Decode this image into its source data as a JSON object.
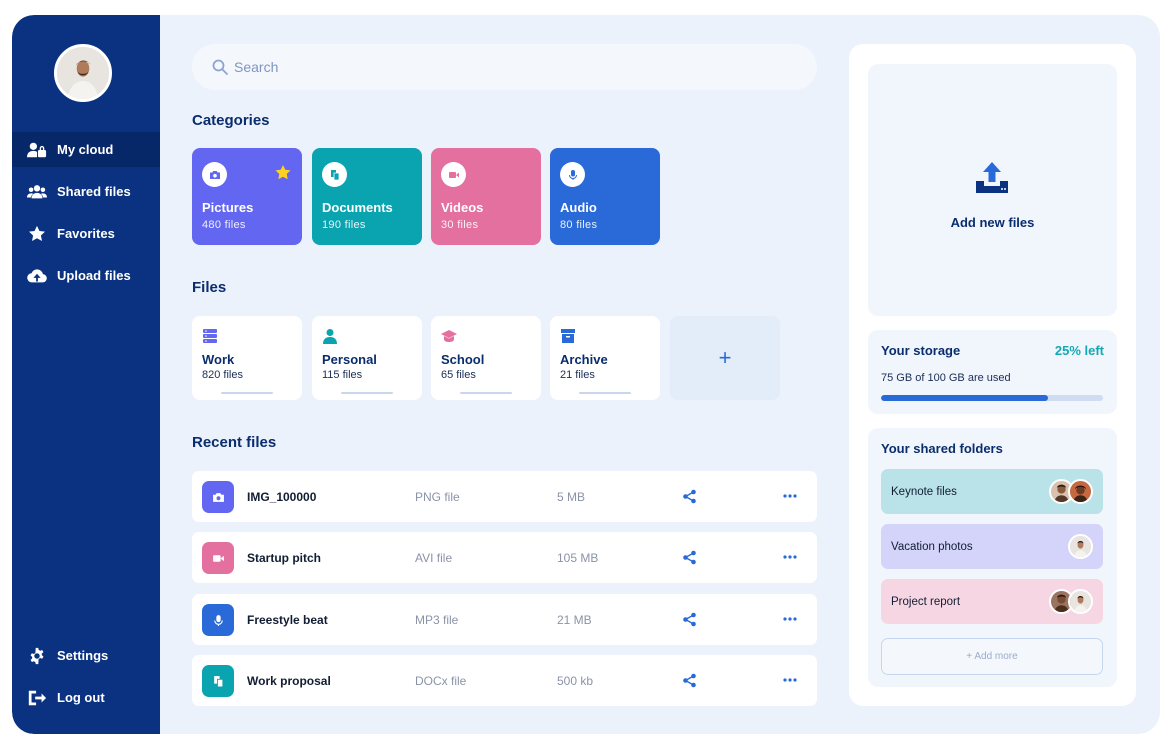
{
  "sidebar": {
    "items": [
      {
        "label": "My cloud",
        "icon": "user-lock-icon",
        "active": true
      },
      {
        "label": "Shared files",
        "icon": "users-icon"
      },
      {
        "label": "Favorites",
        "icon": "star-icon"
      },
      {
        "label": "Upload files",
        "icon": "cloud-upload-icon"
      }
    ],
    "bottom": [
      {
        "label": "Settings",
        "icon": "gear-icon"
      },
      {
        "label": "Log out",
        "icon": "logout-icon"
      }
    ]
  },
  "search": {
    "placeholder": "Search"
  },
  "categories": {
    "title": "Categories",
    "items": [
      {
        "name": "Pictures",
        "count": "480 files",
        "color": "#6266f1",
        "icon": "camera-icon"
      },
      {
        "name": "Documents",
        "count": "190 files",
        "color": "#0aa3b0",
        "icon": "document-icon"
      },
      {
        "name": "Videos",
        "count": "30 files",
        "color": "#e3709f",
        "icon": "video-icon"
      },
      {
        "name": "Audio",
        "count": "80 files",
        "color": "#2a6ad8",
        "icon": "microphone-icon"
      }
    ]
  },
  "files": {
    "title": "Files",
    "items": [
      {
        "name": "Work",
        "count": "820 files",
        "icon": "server-icon",
        "color": "#6266f1"
      },
      {
        "name": "Personal",
        "count": "115 files",
        "icon": "person-icon",
        "color": "#0aa3b0"
      },
      {
        "name": "School",
        "count": "65 files",
        "icon": "graduation-cap-icon",
        "color": "#e3709f"
      },
      {
        "name": "Archive",
        "count": "21 files",
        "icon": "archive-box-icon",
        "color": "#2a6ad8"
      }
    ],
    "add_label": "+"
  },
  "recent": {
    "title": "Recent files",
    "rows": [
      {
        "name": "IMG_100000",
        "type": "PNG file",
        "size": "5 MB",
        "icon": "camera-icon",
        "color": "#6266f1"
      },
      {
        "name": "Startup pitch",
        "type": "AVI file",
        "size": "105 MB",
        "icon": "video-icon",
        "color": "#e3709f"
      },
      {
        "name": "Freestyle beat",
        "type": "MP3 file",
        "size": "21 MB",
        "icon": "microphone-icon",
        "color": "#2a6ad8"
      },
      {
        "name": "Work proposal",
        "type": "DOCx file",
        "size": "500 kb",
        "icon": "document-icon",
        "color": "#0aa3b0"
      }
    ]
  },
  "upload": {
    "label": "Add new files"
  },
  "storage": {
    "title": "Your storage",
    "left": "25% left",
    "used_text": "75 GB of 100 GB are used",
    "used_fraction": 0.75
  },
  "shared": {
    "title": "Your shared folders",
    "folders": [
      {
        "name": "Keynote files",
        "color": "#b9e3e8",
        "avatars": 2
      },
      {
        "name": "Vacation photos",
        "color": "#d4d3fa",
        "avatars": 1
      },
      {
        "name": "Project report",
        "color": "#f7d6e3",
        "avatars": 2
      }
    ],
    "add_more": "+ Add more"
  }
}
